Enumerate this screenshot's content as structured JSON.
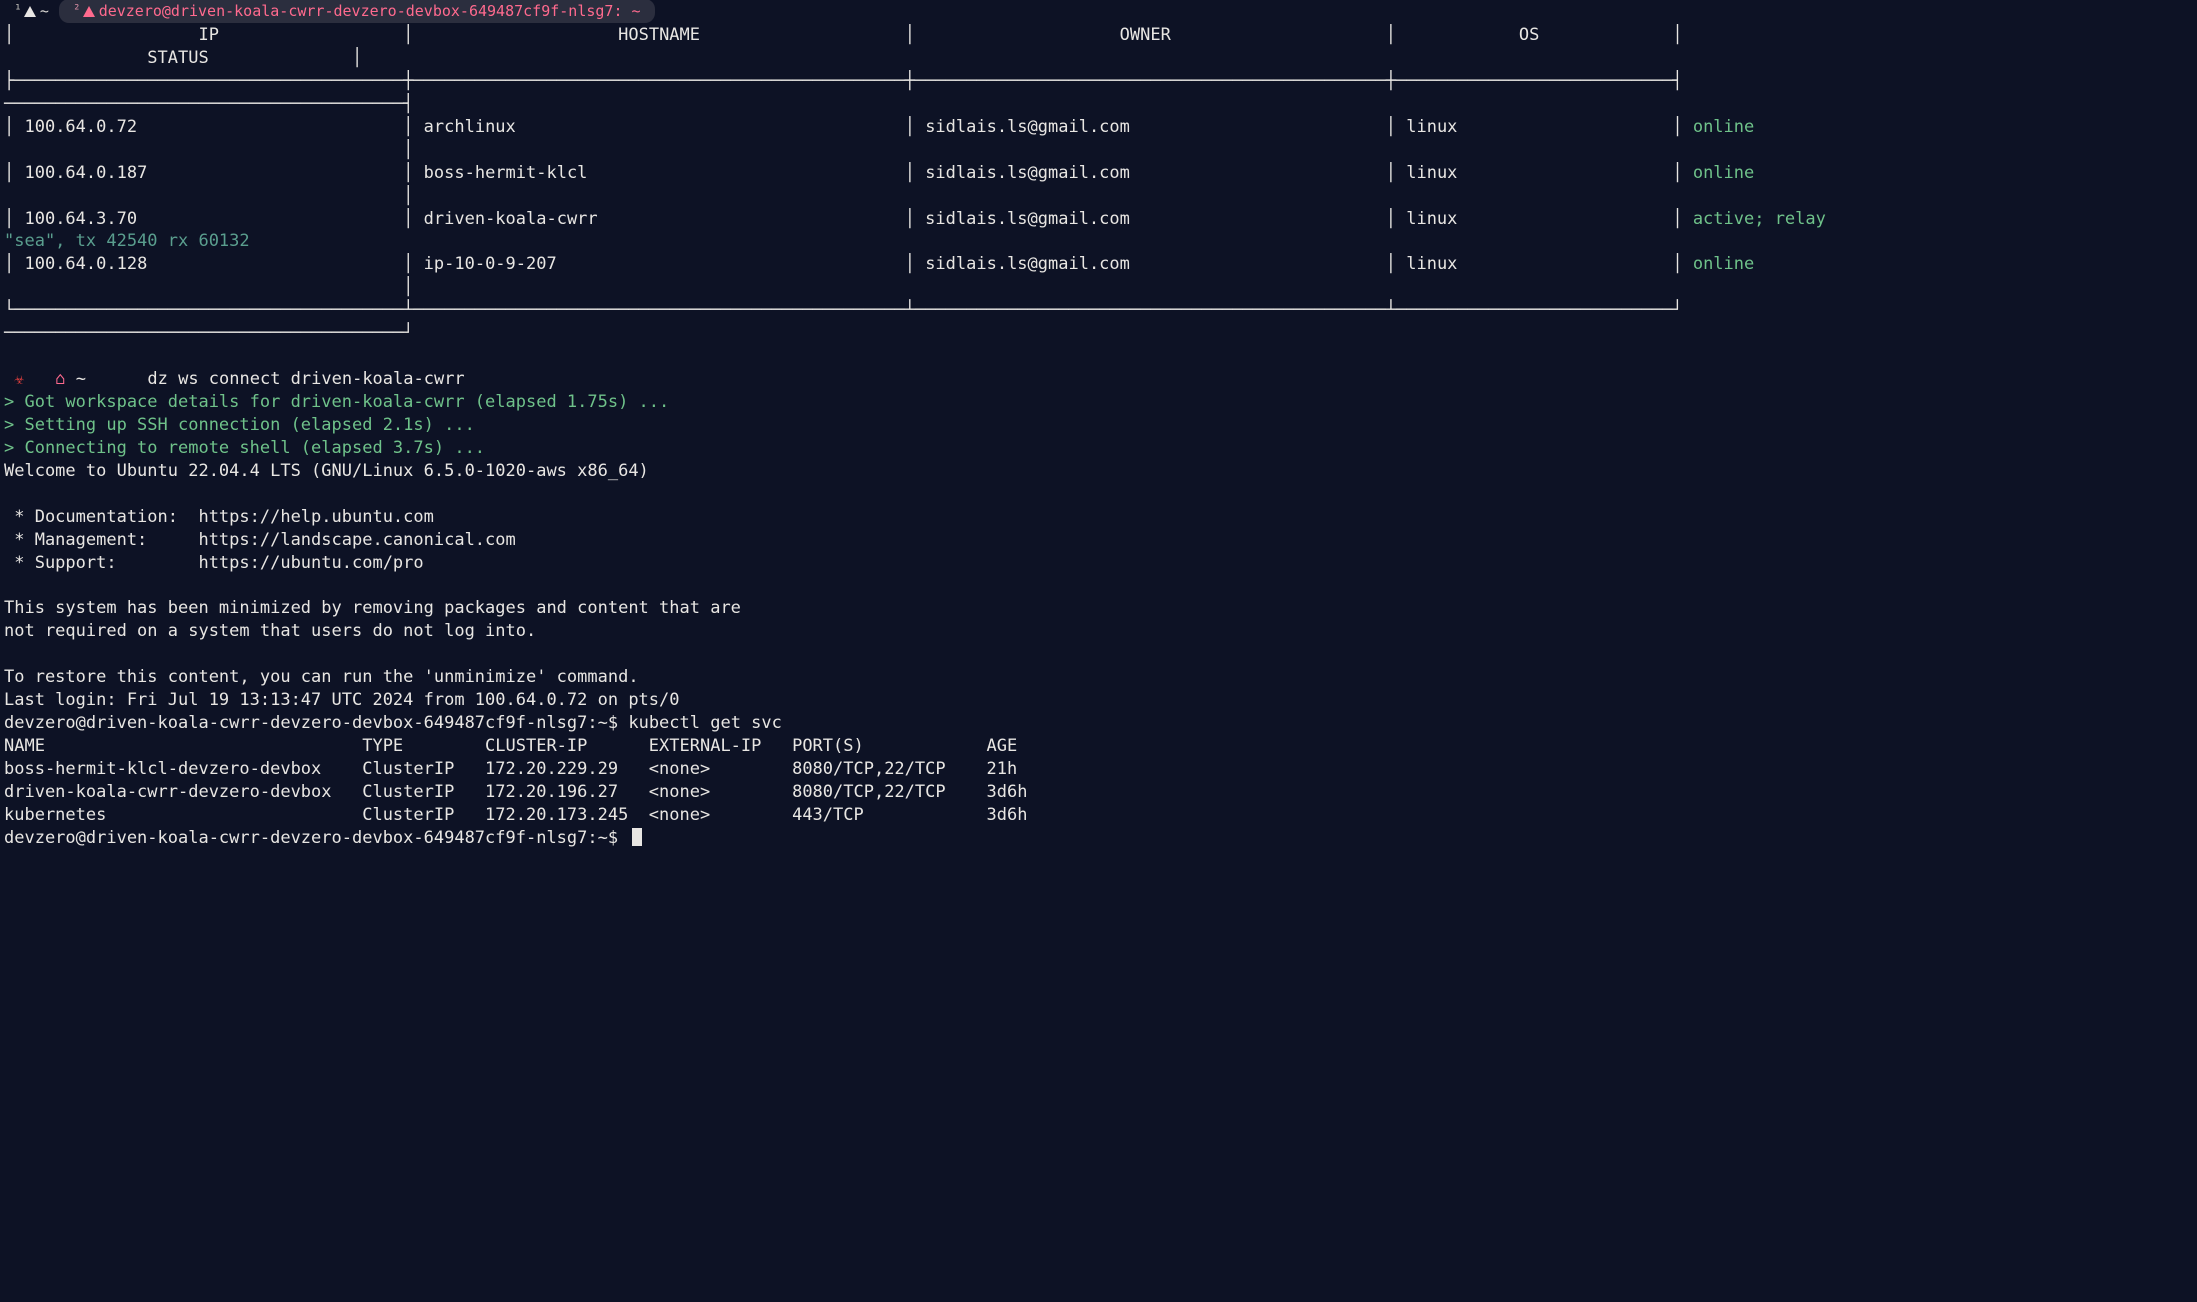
{
  "tabs": {
    "t1": {
      "num": "¹",
      "title": "~"
    },
    "t2": {
      "num": "²",
      "title": "devzero@driven-koala-cwrr-devzero-devbox-649487cf9f-nlsg7: ~"
    }
  },
  "table": {
    "headers": {
      "ip": "IP",
      "hostname": "HOSTNAME",
      "owner": "OWNER",
      "os": "OS",
      "status": "STATUS"
    },
    "rows": [
      {
        "ip": "100.64.0.72",
        "hostname": "archlinux",
        "owner": "sidlais.ls@gmail.com",
        "os": "linux",
        "status": "online",
        "status_color": "green"
      },
      {
        "ip": "100.64.0.187",
        "hostname": "boss-hermit-klcl",
        "owner": "sidlais.ls@gmail.com",
        "os": "linux",
        "status": "online",
        "status_color": "green"
      },
      {
        "ip": "100.64.3.70",
        "hostname": "driven-koala-cwrr",
        "owner": "sidlais.ls@gmail.com",
        "os": "linux",
        "status": "active; relay",
        "status_color": "green",
        "extra": "\"sea\", tx 42540 rx 60132"
      },
      {
        "ip": "100.64.0.128",
        "hostname": "ip-10-0-9-207",
        "owner": "sidlais.ls@gmail.com",
        "os": "linux",
        "status": "online",
        "status_color": "green"
      }
    ]
  },
  "connect": {
    "cmd": "dz ws connect driven-koala-cwrr",
    "l1": "> Got workspace details for driven-koala-cwrr (elapsed 1.75s) ...",
    "l2": "> Setting up SSH connection (elapsed 2.1s) ...",
    "l3": "> Connecting to remote shell (elapsed 3.7s) ..."
  },
  "motd": {
    "welcome": "Welcome to Ubuntu 22.04.4 LTS (GNU/Linux 6.5.0-1020-aws x86_64)",
    "doc": " * Documentation:  https://help.ubuntu.com",
    "mgmt": " * Management:     https://landscape.canonical.com",
    "sup": " * Support:        https://ubuntu.com/pro",
    "min1": "This system has been minimized by removing packages and content that are",
    "min2": "not required on a system that users do not log into.",
    "restore": "To restore this content, you can run the 'unminimize' command.",
    "last": "Last login: Fri Jul 19 13:13:47 UTC 2024 from 100.64.0.72 on pts/0"
  },
  "kube": {
    "prompt": "devzero@driven-koala-cwrr-devzero-devbox-649487cf9f-nlsg7:~$",
    "cmd": "kubectl get svc",
    "hdr": "NAME                               TYPE        CLUSTER-IP      EXTERNAL-IP   PORT(S)            AGE",
    "r1": "boss-hermit-klcl-devzero-devbox    ClusterIP   172.20.229.29   <none>        8080/TCP,22/TCP    21h",
    "r2": "driven-koala-cwrr-devzero-devbox   ClusterIP   172.20.196.27   <none>        8080/TCP,22/TCP    3d6h",
    "r3": "kubernetes                         ClusterIP   172.20.173.245  <none>        443/TCP            3d6h"
  }
}
